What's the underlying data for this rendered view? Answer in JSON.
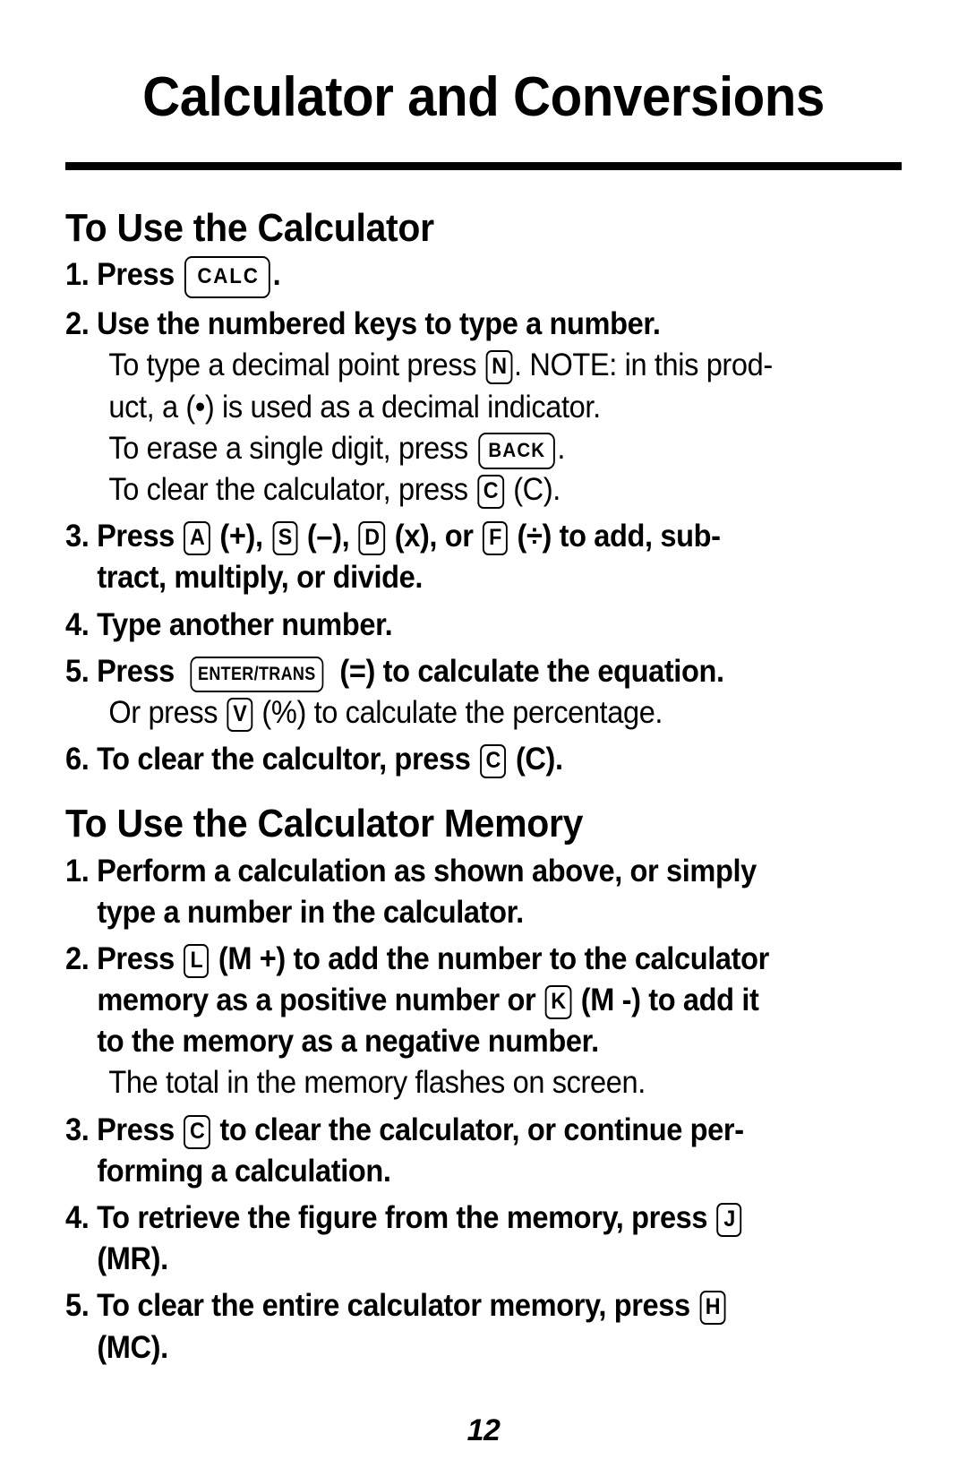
{
  "document": {
    "title": "Calculator and Conversions",
    "page_number": "12"
  },
  "sections": [
    {
      "heading": "To Use the Calculator",
      "steps": [
        {
          "number": "1.",
          "lead": "Press",
          "key": "CALC",
          "key_size": "lg",
          "trail": "."
        },
        {
          "number": "2.",
          "lead": "Use the numbered keys to type a number.",
          "notes": [
            {
              "pre": "To type a decimal point press",
              "key": "N",
              "key_size": "sm",
              "post": ". NOTE: in this prod-",
              "cont": "uct, a (•) is used as a decimal indicator."
            },
            {
              "pre": "To erase a single digit, press",
              "key": "BACK",
              "key_size": "md",
              "post": "."
            },
            {
              "pre": "To clear the calculator, press",
              "key": "C",
              "key_size": "sm",
              "post": " (C)."
            }
          ]
        },
        {
          "number": "3.",
          "lead": "Press",
          "keys_inline": [
            {
              "key": "A",
              "key_size": "sm",
              "after": " (+), "
            },
            {
              "key": "S",
              "key_size": "sm",
              "after": " (–), "
            },
            {
              "key": "D",
              "key_size": "sm",
              "after": " (x), or "
            },
            {
              "key": "F",
              "key_size": "sm",
              "after": " (÷) to add, sub-"
            }
          ],
          "cont": "tract, multiply, or divide."
        },
        {
          "number": "4.",
          "lead": "Type another number."
        },
        {
          "number": "5.",
          "lead": "Press",
          "key": "ENTER/TRANS",
          "key_size": "xl",
          "trail": " (=) to calculate the equation.",
          "notes": [
            {
              "pre": "Or press",
              "key": "V",
              "key_size": "sm",
              "post": " (%) to calculate the percentage."
            }
          ]
        },
        {
          "number": "6.",
          "lead": "To clear the calcultor, press",
          "key": "C",
          "key_size": "sm",
          "trail": " (C)."
        }
      ]
    },
    {
      "heading": "To Use the Calculator Memory",
      "steps": [
        {
          "number": "1.",
          "lead": "Perform a calculation as shown above, or simply",
          "cont": "type a number in the calculator."
        },
        {
          "number": "2.",
          "lead": "Press",
          "key": "L",
          "key_size": "sm",
          "trail": " (M +) to add the number to the calculator",
          "cont_key_line": {
            "pre": "memory as a positive number or",
            "key": "K",
            "key_size": "sm",
            "post": " (M -) to add it"
          },
          "cont2": "to the memory as a negative number.",
          "notes": [
            {
              "pre": "The total in the memory flashes on screen."
            }
          ]
        },
        {
          "number": "3.",
          "lead": "Press",
          "key": "C",
          "key_size": "sm",
          "trail": " to clear the calculator, or continue per-",
          "cont": "forming a calculation."
        },
        {
          "number": "4.",
          "lead": "To retrieve the figure from the memory, press",
          "key": "J",
          "key_size": "sm",
          "cont": "(MR)."
        },
        {
          "number": "5.",
          "lead": "To clear the entire calculator memory, press",
          "key": "H",
          "key_size": "sm",
          "cont": "(MC)."
        }
      ]
    }
  ]
}
